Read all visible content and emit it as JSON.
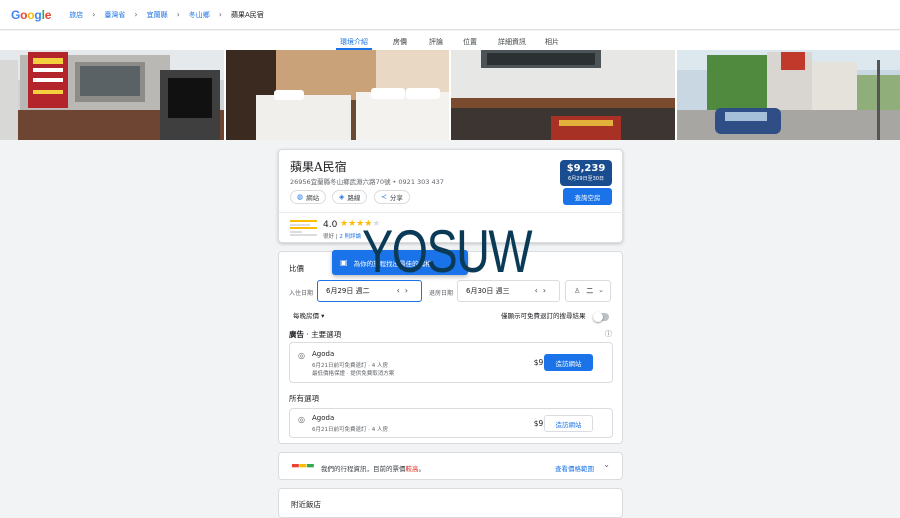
{
  "header": {
    "logo": "Google",
    "breadcrumbs": [
      "旅店",
      "臺灣省",
      "宜蘭縣",
      "冬山鄉",
      "蘋果A民宿"
    ]
  },
  "tabs": [
    "環境介紹",
    "房價",
    "評論",
    "位置",
    "詳細資訊",
    "相片"
  ],
  "hotel": {
    "name": "蘋果A民宿",
    "address": "26956宜蘭縣冬山鄉武淵六路70號 • 0921 303 437",
    "actions": {
      "website": "網站",
      "directions": "路線",
      "share": "分享"
    },
    "rating": "4.0",
    "stars": 4,
    "rating_word": "很好",
    "reviews": "2 則評論",
    "price": "$9,239",
    "price_dates": "6月29日至30日",
    "check_rooms": "查詢空房"
  },
  "compare": {
    "title": "比價",
    "checkin_label": "入住日期",
    "checkin_value": "6月29日 週二",
    "checkout_label": "退房日期",
    "checkout_value": "6月30日 週三",
    "guests": "二",
    "per_night": "每晚房價",
    "free_cancel_only": "僅顯示可免費退訂的搜尋結果",
    "ads_label": "廣告",
    "featured_title": "主要選項",
    "all_title": "所有選項",
    "visit_site": "造訪網站"
  },
  "offers": {
    "featured": {
      "name": "Agoda",
      "line1": "6月21日前可免費退訂 · 4 人房",
      "line2": "最低價格保證 · 提供免費取消方案",
      "price": "$9,239"
    },
    "all": {
      "name": "Agoda",
      "line1": "6月21日前可免費退訂 · 4 人房",
      "price": "$9,239"
    }
  },
  "tooltip": "為你的旅程找出最佳的價格",
  "watermark": "YOSUW",
  "trip": {
    "text_prefix": "我們的行程資訊，目前的票價",
    "text_highlight": "較高",
    "link": "查看價格範圍"
  },
  "next_section": "附近飯店",
  "colors": {
    "accent": "#1a73e8",
    "price_badge": "#1a4d8f",
    "star": "#fbbc04",
    "warn": "#d93025"
  }
}
